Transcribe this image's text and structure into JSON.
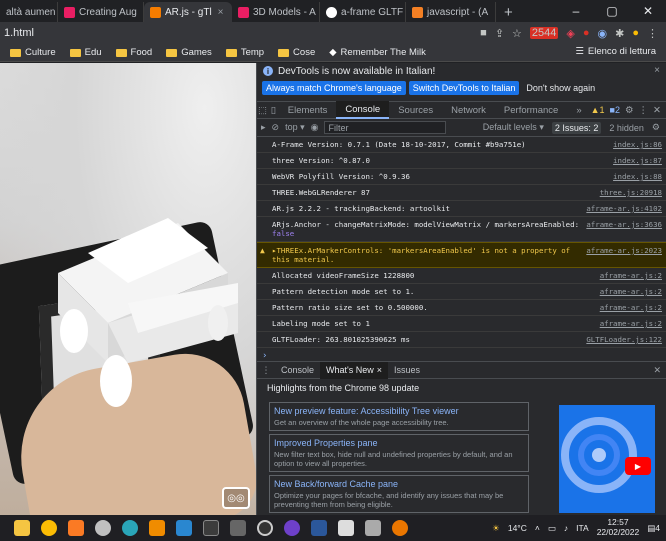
{
  "browser": {
    "tabs": [
      {
        "label": "altà aumen",
        "color": "#1a1a1a",
        "active": false
      },
      {
        "label": "Creating Aug",
        "color": "#e91e63",
        "active": false
      },
      {
        "label": "AR.js - gTl",
        "color": "#f57c00",
        "active": true
      },
      {
        "label": "3D Models - A",
        "color": "#e91e63",
        "active": false
      },
      {
        "label": "a-frame GLTF",
        "color": "#ffffff",
        "active": false
      },
      {
        "label": "javascript - (A",
        "color": "#f48024",
        "active": false
      }
    ],
    "new_tab_label": "+",
    "url": "1.html",
    "badge_count": "2544",
    "bookmarks": [
      {
        "label": "Culture"
      },
      {
        "label": "Edu"
      },
      {
        "label": "Food"
      },
      {
        "label": "Games"
      },
      {
        "label": "Temp"
      },
      {
        "label": "Cose"
      },
      {
        "label": "Remember The Milk"
      }
    ],
    "reading_list": "Elenco di lettura"
  },
  "devtools": {
    "notice": "DevTools is now available in Italian!",
    "btn_match": "Always match Chrome's language",
    "btn_switch": "Switch DevTools to Italian",
    "btn_dismiss": "Don't show again",
    "tabs": [
      "Elements",
      "Console",
      "Sources",
      "Network",
      "Performance"
    ],
    "more_tabs": "»",
    "warn_count": "1",
    "info_count": "2",
    "console": {
      "context": "top",
      "filter_placeholder": "Filter",
      "levels": "Default levels",
      "issues": "2 Issues: 2",
      "hidden": "2 hidden"
    },
    "log": [
      {
        "msg": "A-Frame Version: 0.7.1 (Date 18-10-2017, Commit #b9a751e)",
        "src": "index.js:86",
        "type": "log"
      },
      {
        "msg": "three Version: ^0.87.0",
        "src": "index.js:87",
        "type": "log"
      },
      {
        "msg": "WebVR Polyfill Version: ^0.9.36",
        "src": "index.js:88",
        "type": "log"
      },
      {
        "msg": "THREE.WebGLRenderer 87",
        "src": "three.js:20918",
        "type": "log"
      },
      {
        "msg": "AR.js 2.2.2 - trackingBackend: artoolkit",
        "src": "aframe-ar.js:4102",
        "type": "log"
      },
      {
        "msg": "ARjs.Anchor - changeMatrixMode: modelViewMatrix / markersAreaEnabled:",
        "accent": "false",
        "src": "aframe-ar.js:3636",
        "type": "log"
      },
      {
        "msg": "▸THREEx.ArMarkerControls: 'markersAreaEnabled' is not a property of this material.",
        "src": "aframe-ar.js:2023",
        "type": "warn"
      },
      {
        "msg": "Allocated videoFrameSize 1228800",
        "src": "aframe-ar.js:2",
        "type": "log"
      },
      {
        "msg": "Pattern detection mode set to 1.",
        "src": "aframe-ar.js:2",
        "type": "log"
      },
      {
        "msg": "Pattern ratio size set to 0.500000.",
        "src": "aframe-ar.js:2",
        "type": "log"
      },
      {
        "msg": "Labeling mode set to 1",
        "src": "aframe-ar.js:2",
        "type": "log"
      },
      {
        "msg": "GLTFLoader: 263.801025390625 ms",
        "src": "GLTFLoader.js:122",
        "type": "log"
      }
    ],
    "prompt": "›",
    "drawer": {
      "tabs": [
        "Console",
        "What's New",
        "Issues"
      ],
      "active": 1,
      "highlights": "Highlights from the Chrome 98 update",
      "cards": [
        {
          "title": "New preview feature: Accessibility Tree viewer",
          "desc": "Get an overview of the whole page accessibility tree."
        },
        {
          "title": "Improved Properties pane",
          "desc": "New filter text box, hide null and undefined properties by default, and an option to view all properties."
        },
        {
          "title": "New Back/forward Cache pane",
          "desc": "Optimize your pages for bfcache, and identify any issues that may be preventing them from being eligible."
        }
      ]
    }
  },
  "taskbar": {
    "temperature": "14°C",
    "language": "ITA",
    "time": "12:57",
    "date": "22/02/2022",
    "notifications": "4"
  }
}
